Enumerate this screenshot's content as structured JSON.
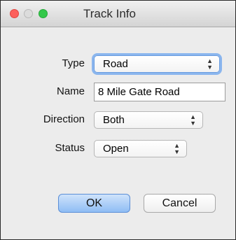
{
  "window": {
    "title": "Track Info"
  },
  "form": {
    "type": {
      "label": "Type",
      "value": "Road"
    },
    "name": {
      "label": "Name",
      "value": "8 Mile Gate Road"
    },
    "direction": {
      "label": "Direction",
      "value": "Both"
    },
    "status": {
      "label": "Status",
      "value": "Open"
    }
  },
  "buttons": {
    "ok": "OK",
    "cancel": "Cancel"
  },
  "colors": {
    "ok_button": "#8fbdf4",
    "close": "#fc605c",
    "zoom": "#34c84a"
  },
  "icons": {
    "popup_arrows": "updown-arrows-icon"
  }
}
